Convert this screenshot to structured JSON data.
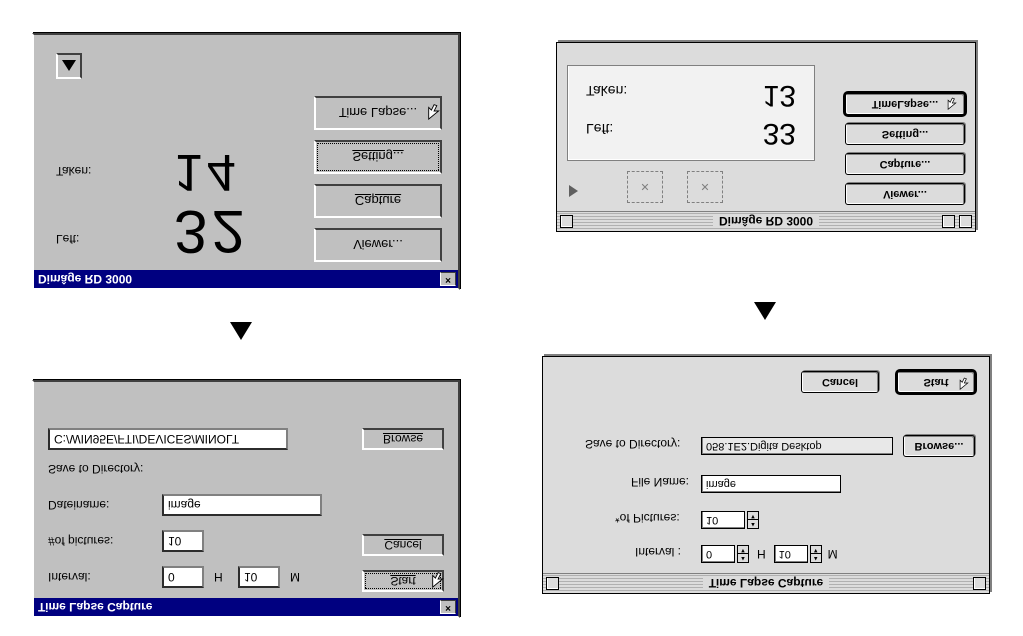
{
  "win_timelapse": {
    "title": "Time Lapse Capture",
    "interval_label": "Interval:",
    "interval_h": "0",
    "interval_h_unit": "H",
    "interval_m": "10",
    "interval_m_unit": "M",
    "pictures_label": "#of pictures:",
    "pictures": "10",
    "dateiname_label": "Dateiname:",
    "dateiname": "image",
    "savedir_label": "Save to Directory:",
    "savedir": "C:/WIN95E/FTI/DEVICES/MINOLT",
    "start": "Start",
    "cancel": "Cancel",
    "browse": "Browse"
  },
  "win_main": {
    "title": "Dimâge RD 3000",
    "left_label": "Left:",
    "left_value": "32",
    "taken_label": "Taken:",
    "taken_value": "14",
    "viewer": "Viewer...",
    "capture": "Capture",
    "setting": "Setting...",
    "timelapse": "Time Lapse..."
  },
  "mac_timelapse": {
    "title": "Time Lapse Capture",
    "interval_label": "Interval :",
    "interval_h": "0",
    "interval_h_unit": "H",
    "interval_m": "10",
    "interval_m_unit": "M",
    "pictures_label": "*of Pictures:",
    "pictures": "10",
    "filename_label": "File Name:",
    "filename": "image",
    "savedir_label": "Save to Directory:",
    "savedir": "058.1E2.Digita Desktop",
    "browse": "Browse...",
    "cancel": "Cancel",
    "start": "Start"
  },
  "mac_main": {
    "title": "Dimâge RD 3000",
    "left_label": "Left:",
    "left_value": "33",
    "taken_label": "Taken:",
    "taken_value": "13",
    "viewer": "Viewer...",
    "capture": "Capture...",
    "setting": "Setting...",
    "timelapse": "TimeLapse..."
  }
}
